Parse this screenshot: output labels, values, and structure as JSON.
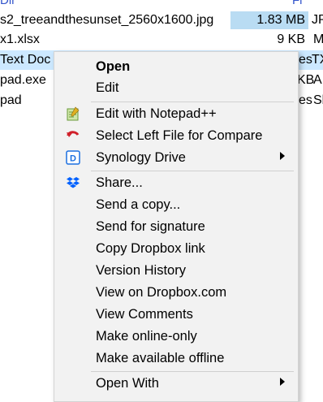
{
  "explorer": {
    "header_name": "Dir",
    "header_type": "Fi",
    "rows": [
      {
        "name": "s2_treeandthesunset_2560x1600.jpg",
        "size": "1.83 MB",
        "type": "JP"
      },
      {
        "name": "x1.xlsx",
        "size": "9 KB",
        "type": "M"
      },
      {
        "name": " Text Doc",
        "size": "es",
        "type": "TX"
      },
      {
        "name": "pad.exe",
        "size": "KB",
        "type": "A"
      },
      {
        "name": "pad",
        "size": "es",
        "type": "Sl"
      }
    ]
  },
  "context_menu": {
    "open": "Open",
    "edit": "Edit",
    "edit_notepadpp": "Edit with Notepad++",
    "select_left_compare": "Select Left File for Compare",
    "synology_drive": "Synology Drive",
    "share": "Share...",
    "send_copy": "Send a copy...",
    "send_signature": "Send for signature",
    "copy_dropbox_link": "Copy Dropbox link",
    "version_history": "Version History",
    "view_on_dropbox": "View on Dropbox.com",
    "view_comments": "View Comments",
    "make_online_only": "Make online-only",
    "make_available_offline": "Make available offline",
    "open_with": "Open With"
  },
  "colors": {
    "selection": "#cce8ff",
    "size_highlight": "#b9dcf3",
    "menu_bg": "#f2f2f2",
    "dropbox_blue": "#0061ff",
    "synology_blue": "#1b6fe0"
  }
}
